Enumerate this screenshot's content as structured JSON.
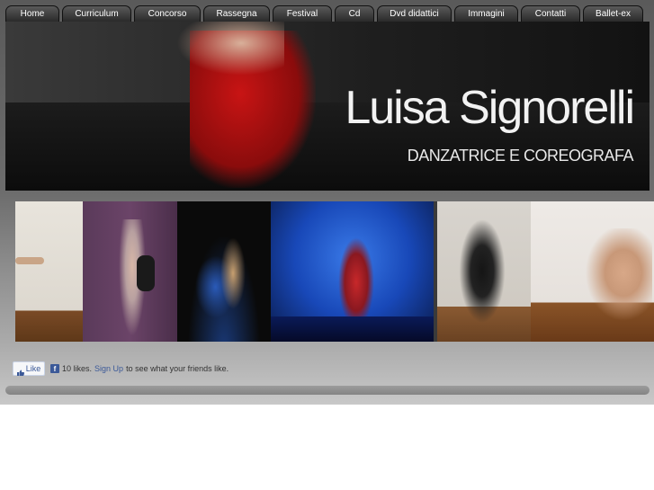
{
  "nav": {
    "items": [
      {
        "label": "Home"
      },
      {
        "label": "Curriculum"
      },
      {
        "label": "Concorso"
      },
      {
        "label": "Rassegna"
      },
      {
        "label": "Festival"
      },
      {
        "label": "Cd"
      },
      {
        "label": "Dvd didattici"
      },
      {
        "label": "Immagini"
      },
      {
        "label": "Contatti"
      },
      {
        "label": "Ballet-ex"
      }
    ]
  },
  "header": {
    "title": "Luisa Signorelli",
    "subtitle": "DANZATRICE E COREOGRAFA"
  },
  "social": {
    "like_label": "Like",
    "fb_icon": "f",
    "count_text": "10 likes.",
    "signup_label": "Sign Up",
    "suffix_text": "to see what your friends like."
  },
  "colors": {
    "accent": "#3b5998",
    "nav_tab": "#3a3a3a"
  }
}
